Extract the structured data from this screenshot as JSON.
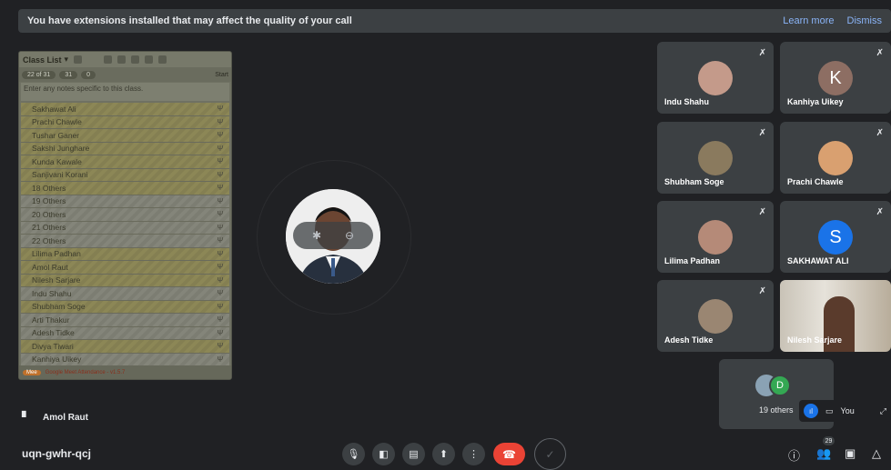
{
  "banner": {
    "message": "You have extensions installed that may affect the quality of your call",
    "learn_more": "Learn more",
    "dismiss": "Dismiss"
  },
  "class_list": {
    "title": "Class List",
    "notes_placeholder": "Enter any notes specific to this class.",
    "stats": [
      "22 of 31",
      "31",
      "0",
      "Start"
    ],
    "students": [
      {
        "name": "Sakhawat Ali",
        "highlight": true
      },
      {
        "name": "Prachi Chawle",
        "highlight": true
      },
      {
        "name": "Tushar Ganer",
        "highlight": true
      },
      {
        "name": "Sakshi Junghare",
        "highlight": true
      },
      {
        "name": "Kunda Kawale",
        "highlight": true
      },
      {
        "name": "Sanjivani Korani",
        "highlight": true
      },
      {
        "name": "18 Others",
        "highlight": true
      },
      {
        "name": "19 Others",
        "highlight": false
      },
      {
        "name": "20 Others",
        "highlight": false
      },
      {
        "name": "21 Others",
        "highlight": false
      },
      {
        "name": "22 Others",
        "highlight": false
      },
      {
        "name": "Lilima Padhan",
        "highlight": true
      },
      {
        "name": "Amol Raut",
        "highlight": true
      },
      {
        "name": "Nilesh Sarjare",
        "highlight": true
      },
      {
        "name": "Indu Shahu",
        "highlight": false
      },
      {
        "name": "Shubham Soge",
        "highlight": true
      },
      {
        "name": "Arti Thakur",
        "highlight": false
      },
      {
        "name": "Adesh Tidke",
        "highlight": false
      },
      {
        "name": "Divya Tiwari",
        "highlight": true
      },
      {
        "name": "Kanhiya Uikey",
        "highlight": false
      }
    ],
    "footer": "Google Meet Attendance - v1.5.7"
  },
  "main": {
    "speaker_name": "Amol Raut"
  },
  "tiles": [
    {
      "name": "Indu Shahu",
      "type": "photo",
      "color": "#c49a8a"
    },
    {
      "name": "Kanhiya Uikey",
      "type": "letter",
      "letter": "K",
      "color": "#8d6e63"
    },
    {
      "name": "Shubham Soge",
      "type": "photo",
      "color": "#8a7a5e"
    },
    {
      "name": "Prachi Chawle",
      "type": "photo",
      "color": "#d9a070"
    },
    {
      "name": "Lilima Padhan",
      "type": "photo",
      "color": "#b58a78"
    },
    {
      "name": "SAKHAWAT ALI",
      "type": "letter",
      "letter": "S",
      "color": "#1a73e8"
    },
    {
      "name": "Adesh Tidke",
      "type": "photo",
      "color": "#9a8672"
    },
    {
      "name": "Nilesh Sarjare",
      "type": "video",
      "color": "#c9c3b7"
    }
  ],
  "others": {
    "label": "19 others",
    "letter": "D"
  },
  "self": {
    "label": "You"
  },
  "meeting": {
    "code": "uqn-gwhr-qcj",
    "participant_count": "29"
  }
}
